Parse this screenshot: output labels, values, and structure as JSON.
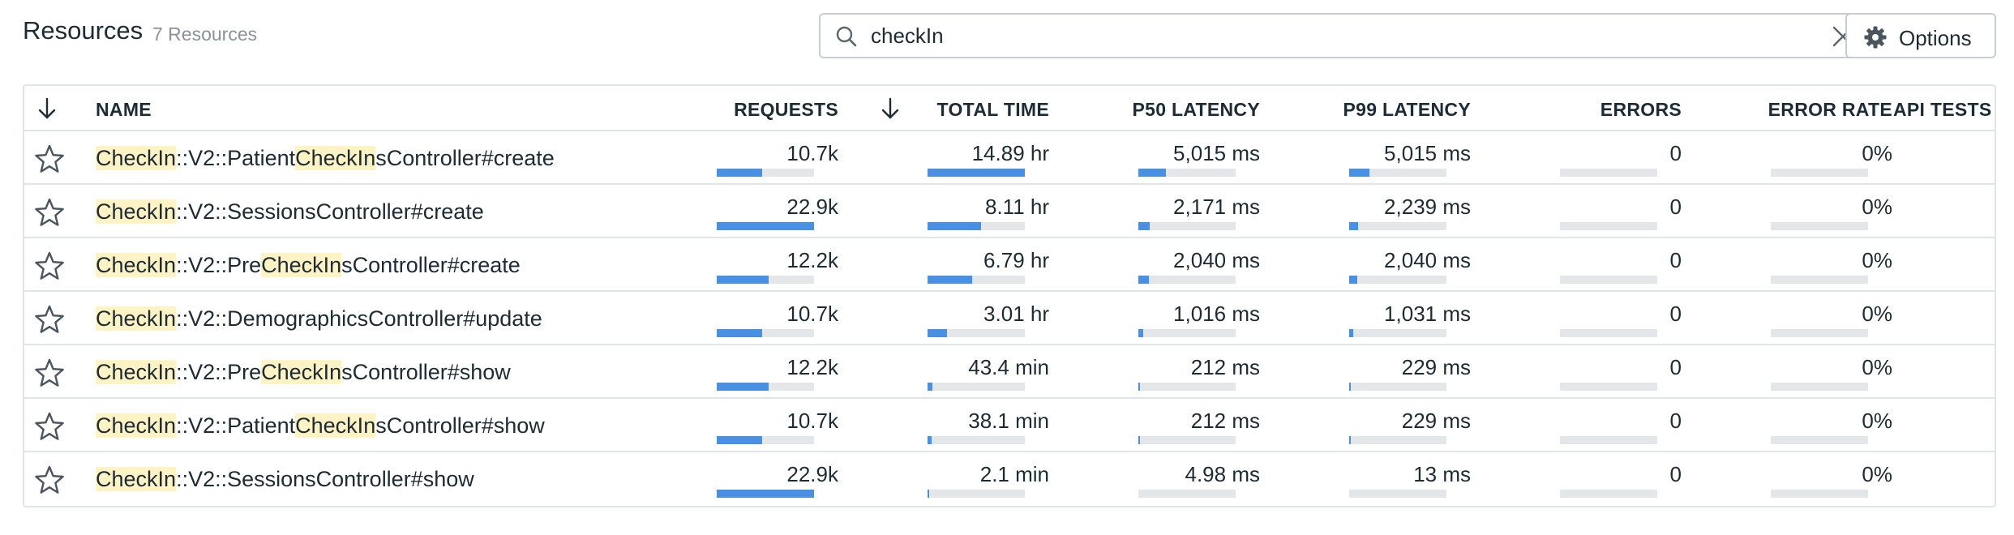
{
  "header": {
    "title": "Resources",
    "count": "7 Resources"
  },
  "search": {
    "value": "checkIn",
    "placeholder": ""
  },
  "options_label": "Options",
  "columns": {
    "name": "NAME",
    "requests": "REQUESTS",
    "total_time": "TOTAL TIME",
    "p50": "P50 LATENCY",
    "p99": "P99 LATENCY",
    "errors": "ERRORS",
    "error_rate": "ERROR RATE",
    "api_tests": "API TESTS"
  },
  "sort": {
    "column": "TOTAL TIME",
    "direction": "descending"
  },
  "colors": {
    "bar_fill": "#4a90e2",
    "bar_track": "#e4e6ea",
    "highlight": "#fdf3c4"
  },
  "rows": [
    {
      "name_parts": [
        {
          "text": "CheckIn",
          "hl": true
        },
        {
          "text": "::V2::Patient",
          "hl": false
        },
        {
          "text": "CheckIn",
          "hl": true
        },
        {
          "text": "sController#create",
          "hl": false
        }
      ],
      "requests": "10.7k",
      "requests_fill": 0.47,
      "total_time": "14.89 hr",
      "total_time_fill": 1.0,
      "p50": "5,015 ms",
      "p50_fill": 0.28,
      "p99": "5,015 ms",
      "p99_fill": 0.21,
      "errors": "0",
      "errors_fill": 0,
      "error_rate": "0%",
      "error_rate_fill": 0
    },
    {
      "name_parts": [
        {
          "text": "CheckIn",
          "hl": true
        },
        {
          "text": "::V2::SessionsController#create",
          "hl": false
        }
      ],
      "requests": "22.9k",
      "requests_fill": 1.0,
      "total_time": "8.11 hr",
      "total_time_fill": 0.55,
      "p50": "2,171 ms",
      "p50_fill": 0.12,
      "p99": "2,239 ms",
      "p99_fill": 0.09,
      "errors": "0",
      "errors_fill": 0,
      "error_rate": "0%",
      "error_rate_fill": 0
    },
    {
      "name_parts": [
        {
          "text": "CheckIn",
          "hl": true
        },
        {
          "text": "::V2::Pre",
          "hl": false
        },
        {
          "text": "CheckIn",
          "hl": true
        },
        {
          "text": "sController#create",
          "hl": false
        }
      ],
      "requests": "12.2k",
      "requests_fill": 0.53,
      "total_time": "6.79 hr",
      "total_time_fill": 0.46,
      "p50": "2,040 ms",
      "p50_fill": 0.11,
      "p99": "2,040 ms",
      "p99_fill": 0.08,
      "errors": "0",
      "errors_fill": 0,
      "error_rate": "0%",
      "error_rate_fill": 0
    },
    {
      "name_parts": [
        {
          "text": "CheckIn",
          "hl": true
        },
        {
          "text": "::V2::DemographicsController#update",
          "hl": false
        }
      ],
      "requests": "10.7k",
      "requests_fill": 0.47,
      "total_time": "3.01 hr",
      "total_time_fill": 0.2,
      "p50": "1,016 ms",
      "p50_fill": 0.05,
      "p99": "1,031 ms",
      "p99_fill": 0.04,
      "errors": "0",
      "errors_fill": 0,
      "error_rate": "0%",
      "error_rate_fill": 0
    },
    {
      "name_parts": [
        {
          "text": "CheckIn",
          "hl": true
        },
        {
          "text": "::V2::Pre",
          "hl": false
        },
        {
          "text": "CheckIn",
          "hl": true
        },
        {
          "text": "sController#show",
          "hl": false
        }
      ],
      "requests": "12.2k",
      "requests_fill": 0.53,
      "total_time": "43.4 min",
      "total_time_fill": 0.05,
      "p50": "212 ms",
      "p50_fill": 0.01,
      "p99": "229 ms",
      "p99_fill": 0.01,
      "errors": "0",
      "errors_fill": 0,
      "error_rate": "0%",
      "error_rate_fill": 0
    },
    {
      "name_parts": [
        {
          "text": "CheckIn",
          "hl": true
        },
        {
          "text": "::V2::Patient",
          "hl": false
        },
        {
          "text": "CheckIn",
          "hl": true
        },
        {
          "text": "sController#show",
          "hl": false
        }
      ],
      "requests": "10.7k",
      "requests_fill": 0.47,
      "total_time": "38.1 min",
      "total_time_fill": 0.04,
      "p50": "212 ms",
      "p50_fill": 0.01,
      "p99": "229 ms",
      "p99_fill": 0.01,
      "errors": "0",
      "errors_fill": 0,
      "error_rate": "0%",
      "error_rate_fill": 0
    },
    {
      "name_parts": [
        {
          "text": "CheckIn",
          "hl": true
        },
        {
          "text": "::V2::SessionsController#show",
          "hl": false
        }
      ],
      "requests": "22.9k",
      "requests_fill": 1.0,
      "total_time": "2.1 min",
      "total_time_fill": 0.003,
      "p50": "4.98 ms",
      "p50_fill": 0,
      "p99": "13 ms",
      "p99_fill": 0,
      "errors": "0",
      "errors_fill": 0,
      "error_rate": "0%",
      "error_rate_fill": 0
    }
  ]
}
